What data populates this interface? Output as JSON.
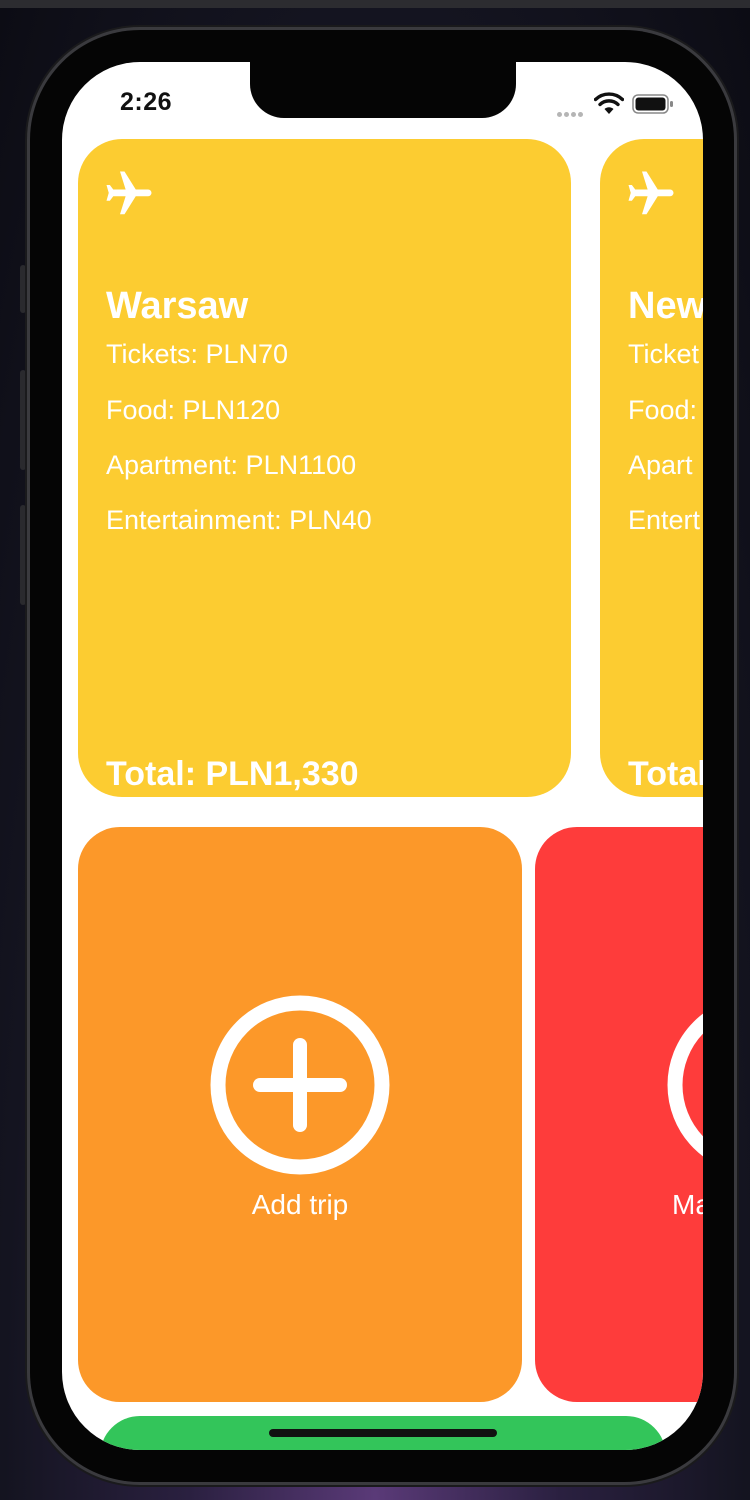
{
  "status_bar": {
    "time": "2:26"
  },
  "trips": [
    {
      "city": "Warsaw",
      "tickets": "Tickets: PLN70",
      "food": "Food: PLN120",
      "apartment": "Apartment: PLN1100",
      "entertainment": "Entertainment: PLN40",
      "total": "Total: PLN1,330"
    },
    {
      "city": "New",
      "tickets": "Ticket",
      "food": "Food:",
      "apartment": "Apart",
      "entertainment": "Entert",
      "total": "Total"
    }
  ],
  "actions": {
    "add_trip_label": "Add trip",
    "second_label": "Ma"
  },
  "colors": {
    "trip_card": "#fccc31",
    "add_tile": "#fc9829",
    "red_tile": "#fe3c3b",
    "green_tile": "#33c55a"
  },
  "icons": {
    "trip": "airplane-icon",
    "add": "plus-circle-icon"
  }
}
